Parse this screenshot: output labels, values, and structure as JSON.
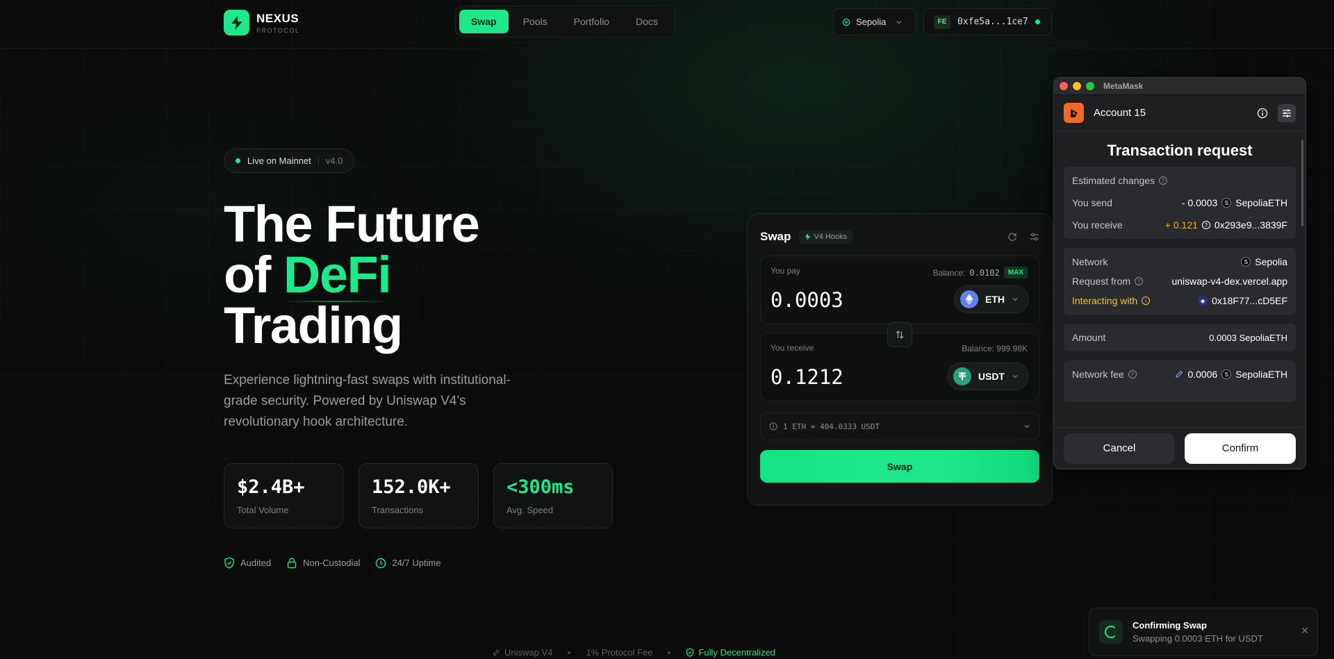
{
  "nav": {
    "brand": "NEXUS",
    "brand_sub": "PROTOCOL",
    "tabs": [
      "Swap",
      "Pools",
      "Portfolio",
      "Docs"
    ],
    "active_tab": "Swap",
    "network": "Sepolia",
    "account_badge": "FE",
    "account": "0xfe5a...1ce7"
  },
  "hero": {
    "status": "Live on Mainnet",
    "version": "v4.0",
    "title_line1": "The Future",
    "title_of": "of ",
    "title_accent": "DeFi",
    "title_line3": "Trading",
    "description": "Experience lightning-fast swaps with institutional-grade security. Powered by Uniswap V4's revolutionary hook architecture.",
    "stats": [
      {
        "value": "$2.4B+",
        "label": "Total Volume"
      },
      {
        "value": "152.0K+",
        "label": "Transactions"
      },
      {
        "value": "<300ms",
        "label": "Avg. Speed"
      }
    ],
    "badges": [
      "Audited",
      "Non-Custodial",
      "24/7 Uptime"
    ]
  },
  "footer": {
    "items": [
      "Uniswap V4",
      "1% Protocol Fee",
      "Fully Decentralized"
    ]
  },
  "swap": {
    "title": "Swap",
    "hook_badge": "V4 Hooks",
    "pay_label": "You pay",
    "pay_balance_label": "Balance:",
    "pay_balance": "0.0102",
    "max_label": "MAX",
    "pay_amount": "0.0003",
    "pay_token": "ETH",
    "receive_label": "You receive",
    "receive_balance": "Balance: 999.98K",
    "receive_amount": "0.1212",
    "receive_token": "USDT",
    "rate": "1 ETH = 404.0333 USDT",
    "button": "Swap"
  },
  "metamask": {
    "window_title": "MetaMask",
    "account": "Account 15",
    "heading": "Transaction request",
    "estimated_changes": "Estimated changes",
    "you_send_label": "You send",
    "you_send_value": "- 0.0003",
    "you_send_token": "SepoliaETH",
    "you_receive_label": "You receive",
    "you_receive_value": "+ 0.121",
    "you_receive_token": "0x293e9...3839F",
    "network_label": "Network",
    "network_value": "Sepolia",
    "request_from_label": "Request from",
    "request_from_value": "uniswap-v4-dex.vercel.app",
    "interacting_label": "Interacting with",
    "interacting_value": "0x18F77...cD5EF",
    "amount_label": "Amount",
    "amount_value": "0.0003 SepoliaETH",
    "fee_label": "Network fee",
    "fee_value": "0.0006",
    "fee_token": "SepoliaETH",
    "cancel": "Cancel",
    "confirm": "Confirm"
  },
  "toast": {
    "title": "Confirming Swap",
    "message": "Swapping 0.0003 ETH for USDT"
  },
  "colors": {
    "accent": "#1ee88a",
    "background": "#0a0b0a",
    "warning": "#f0c43a",
    "metamask_orange": "#f2682b"
  }
}
